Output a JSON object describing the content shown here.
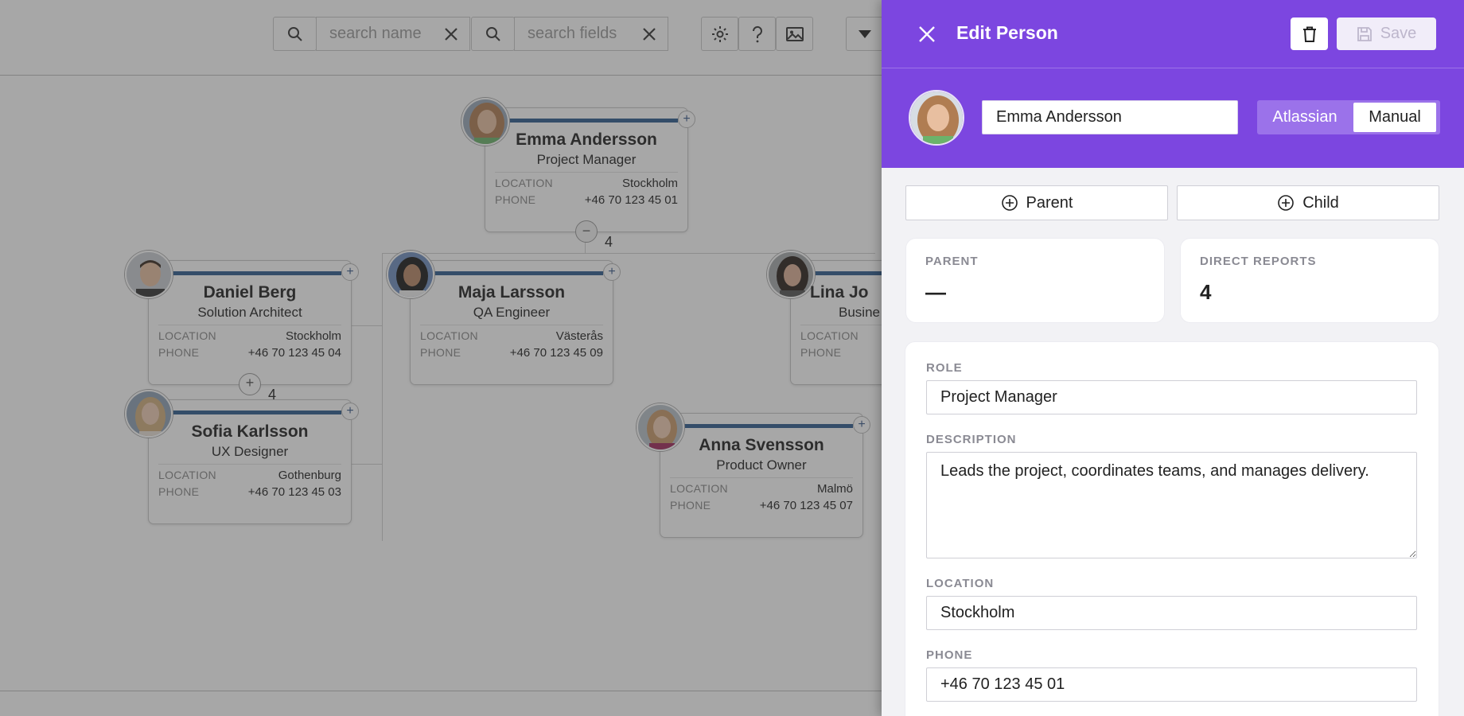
{
  "toolbar": {
    "search_name_placeholder": "search name",
    "search_fields_placeholder": "search fields"
  },
  "people": [
    {
      "name": "Emma Andersson",
      "role": "Project Manager",
      "location": "Stockholm",
      "phone": "+46 70 123 45 01",
      "reports": "4"
    },
    {
      "name": "Daniel Berg",
      "role": "Solution Architect",
      "location": "Stockholm",
      "phone": "+46 70 123 45 04",
      "reports": "4"
    },
    {
      "name": "Maja Larsson",
      "role": "QA Engineer",
      "location": "Västerås",
      "phone": "+46 70 123 45 09"
    },
    {
      "name": "Lina Jo",
      "role": "Busine"
    },
    {
      "name": "Sofia Karlsson",
      "role": "UX Designer",
      "location": "Gothenburg",
      "phone": "+46 70 123 45 03"
    },
    {
      "name": "Anna Svensson",
      "role": "Product Owner",
      "location": "Malmö",
      "phone": "+46 70 123 45 07"
    }
  ],
  "card_labels": {
    "location": "LOCATION",
    "phone": "PHONE"
  },
  "panel": {
    "title": "Edit Person",
    "save_label": "Save",
    "name_value": "Emma Andersson",
    "source_options": [
      "Atlassian",
      "Manual"
    ],
    "selected_source": "Manual",
    "add_parent_label": "Parent",
    "add_child_label": "Child",
    "parent_label": "PARENT",
    "parent_value": "—",
    "direct_reports_label": "DIRECT REPORTS",
    "direct_reports_value": "4",
    "role_label": "ROLE",
    "role_value": "Project Manager",
    "description_label": "DESCRIPTION",
    "description_value": "Leads the project, coordinates teams, and manages delivery.",
    "location_label": "LOCATION",
    "location_value": "Stockholm",
    "phone_label": "PHONE",
    "phone_value": "+46 70 123 45 01"
  },
  "colors": {
    "accent": "#7c46e0",
    "card_bar": "#2e5b8e"
  }
}
